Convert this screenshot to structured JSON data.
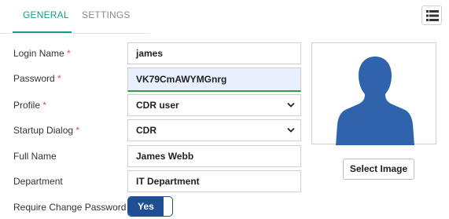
{
  "tabs": {
    "general": "GENERAL",
    "settings": "SETTINGS"
  },
  "form": {
    "login_name": {
      "label": "Login Name",
      "required": "*",
      "value": "james"
    },
    "password": {
      "label": "Password",
      "required": "*",
      "value": "VK79CmAWYMGnrg"
    },
    "profile": {
      "label": "Profile",
      "required": "*",
      "value": "CDR user"
    },
    "startup_dialog": {
      "label": "Startup Dialog",
      "required": "*",
      "value": "CDR"
    },
    "full_name": {
      "label": "Full Name",
      "value": "James Webb"
    },
    "department": {
      "label": "Department",
      "value": "IT Department"
    },
    "require_change_password": {
      "label": "Require Change Password",
      "value": "Yes"
    }
  },
  "photo": {
    "icon": "user-silhouette-icon",
    "button_label": "Select Image"
  },
  "colors": {
    "accent": "#1a9a8c",
    "toggle": "#1e4f95",
    "avatar": "#2f64ad",
    "required": "#d9534f",
    "password_bar": "#2fa03a"
  }
}
